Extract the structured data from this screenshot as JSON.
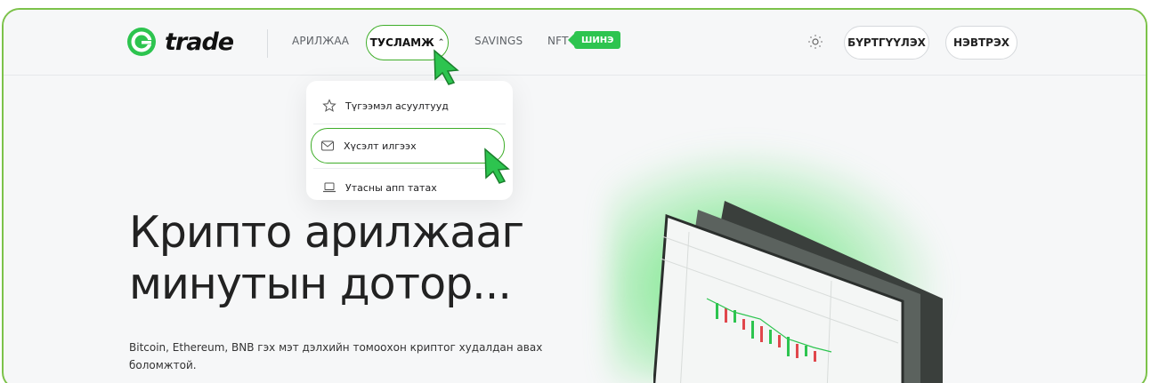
{
  "brand": {
    "name": "trade",
    "color": "#2dc44f"
  },
  "nav": {
    "trade_label": "АРИЛЖАА",
    "help_label": "ТУСЛАМЖ",
    "savings_label": "SAVINGS",
    "nft_label": "NFT",
    "new_badge": "ШИНЭ",
    "register_label": "БҮРТГҮҮЛЭХ",
    "login_label": "НЭВТРЭХ"
  },
  "dropdown": {
    "items": [
      {
        "label": "Түгээмэл асуултууд",
        "icon": "star-icon"
      },
      {
        "label": "Хүсэлт илгээх",
        "icon": "mail-icon"
      },
      {
        "label": "Утасны апп татах",
        "icon": "laptop-icon"
      }
    ]
  },
  "hero": {
    "title_line1": "Крипто арилжааг",
    "title_line2": "минутын дотор...",
    "subtitle": "Bitcoin, Ethereum, BNB гэх мэт дэлхийн томоохон криптог худалдан авах боломжтой."
  },
  "colors": {
    "accent": "#3fae2a",
    "frame": "#7cc24a"
  }
}
